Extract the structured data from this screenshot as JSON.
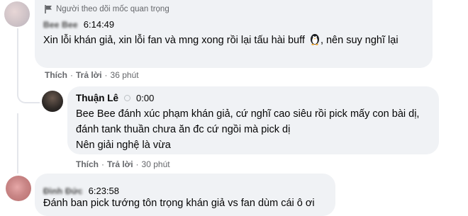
{
  "comments": [
    {
      "badge": "Người theo dõi mốc quan trọng",
      "author": "Bee Bee",
      "time": "6:14:49",
      "text_before": "Xin lỗi khán giả, xin lỗi fan và mng xong rồi lại tấu hài buff ",
      "emoji": "penguin-icon",
      "text_after": ", nên suy nghĩ lại",
      "actions": {
        "like": "Thích",
        "reply": "Trả lời",
        "age": "36 phút"
      }
    },
    {
      "author": "Thuận Lê",
      "time": "0:00",
      "line1": "Bee Bee đánh xúc phạm khán giả, cứ nghĩ cao siêu rồi pick mấy con bài dị, đánh tank thuần chưa ăn đc cứ ngồi mà pick dị",
      "line2": "Nên giải nghệ là vừa",
      "actions": {
        "like": "Thích",
        "reply": "Trả lời",
        "age": "30 phút"
      }
    },
    {
      "author": "Đình Đức",
      "time": "6:23:58",
      "text": "Đánh ban pick tướng tôn trọng khán giả vs fan dùm cái ô ơi"
    }
  ],
  "colors": {
    "bubble": "#f0f2f5",
    "secondary_text": "#65676b",
    "thread_line": "#e4e6eb"
  }
}
